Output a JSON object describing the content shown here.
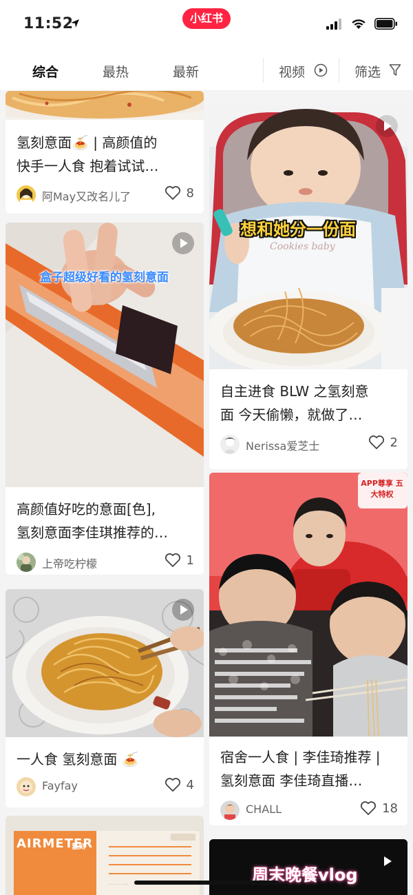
{
  "status_bar": {
    "time": "11:52",
    "app_logo": "小红书"
  },
  "tabs": [
    {
      "label": "综合",
      "active": true
    },
    {
      "label": "最热",
      "active": false
    },
    {
      "label": "最新",
      "active": false
    },
    {
      "label": "视频",
      "active": false,
      "icon": "play-circle-icon"
    },
    {
      "label": "筛选",
      "active": false,
      "icon": "filter-icon"
    }
  ],
  "cards": [
    {
      "title_1": "氢刻意面🍝 | 高颜值的",
      "title_2": "快手一人食 抱着试试…",
      "author": "阿May又改名儿了",
      "likes": "8",
      "video": false
    },
    {
      "image_caption": "盒子超级好看的氢刻意面",
      "title_1": "高颜值好吃的意面[色],",
      "title_2": "氢刻意面李佳琪推荐的…",
      "author": "上帝吃柠檬",
      "likes": "1",
      "video": true
    },
    {
      "title_1": "一人食 氢刻意面 🍝",
      "author": "Fayfay",
      "likes": "4",
      "video": true
    },
    {
      "image_caption": "AIRMETER",
      "package_sub": "氢刻",
      "video": false
    },
    {
      "image_caption": "想和她分一份面",
      "bib_text": "Cookies baby",
      "title_1": "自主进食 BLW 之氢刻意",
      "title_2": "面 今天偷懒，就做了…",
      "author": "Nerissa爱芝士",
      "likes": "2",
      "video": true
    },
    {
      "badge": "APP尊享 五大特权",
      "title_1": "宿舍一人食 | 李佳琦推荐 |",
      "title_2": "氢刻意面 李佳琦直播…",
      "author": "CHALL",
      "likes": "18",
      "video": false
    },
    {
      "image_caption": "周末晚餐vlog",
      "video": true
    }
  ],
  "colors": {
    "brand": "#ff2442",
    "caption_yellow": "#ffd33a",
    "caption_blue": "#3a8cff"
  }
}
